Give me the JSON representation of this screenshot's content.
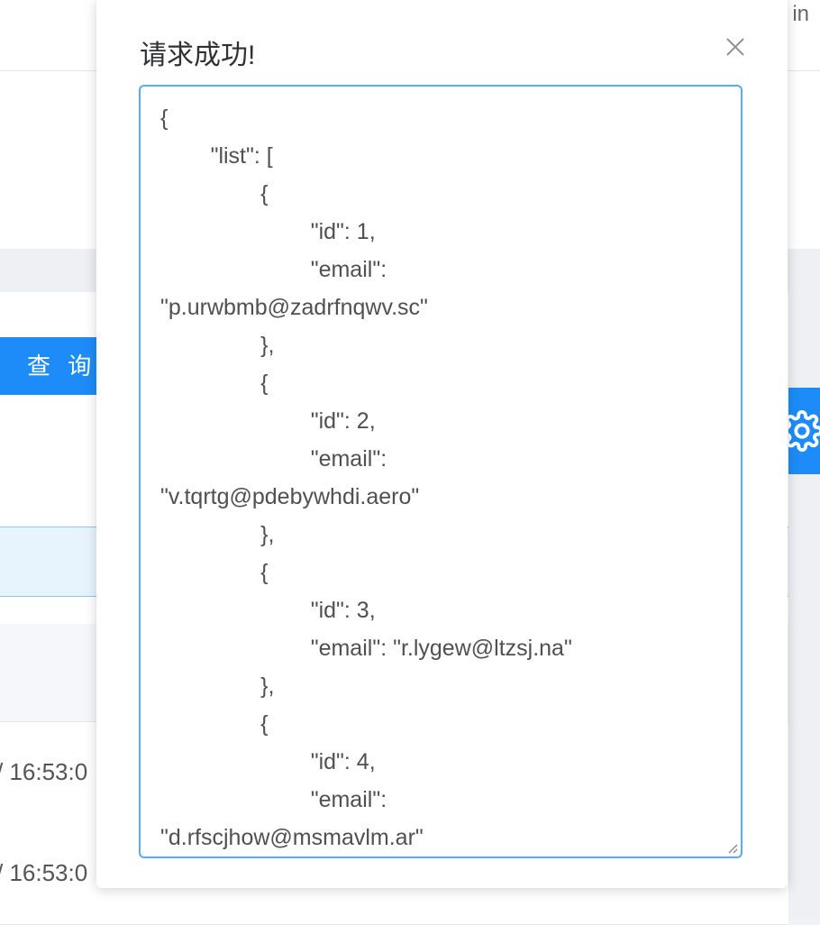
{
  "background": {
    "header_text": "in",
    "query_button_label": "查 询",
    "row_times": [
      "/ 16:53:0",
      "/ 16:53:0"
    ],
    "settings_icon": "gear-icon"
  },
  "modal": {
    "title": "请求成功!",
    "close_icon": "close-icon",
    "json_lines": [
      "{",
      "        \"list\": [",
      "                {",
      "                        \"id\": 1,",
      "                        \"email\":",
      "\"p.urwbmb@zadrfnqwv.sc\"",
      "                },",
      "                {",
      "                        \"id\": 2,",
      "                        \"email\":",
      "\"v.tqrtg@pdebywhdi.aero\"",
      "                },",
      "                {",
      "                        \"id\": 3,",
      "                        \"email\": \"r.lygew@ltzsj.na\"",
      "                },",
      "                {",
      "                        \"id\": 4,",
      "                        \"email\":",
      "\"d.rfscjhow@msmavlm.ar\""
    ]
  },
  "colors": {
    "accent": "#1d8cf8",
    "textarea_border": "#5aaaf0"
  }
}
